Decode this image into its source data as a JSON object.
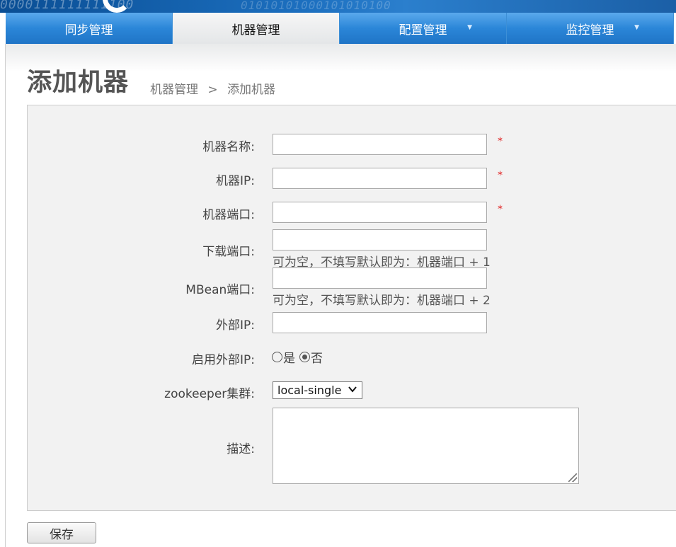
{
  "banner": {
    "digits_left": "0000111111111100",
    "digits_right": "01010101000101010100"
  },
  "nav": {
    "tabs": [
      {
        "label": "同步管理",
        "active": false,
        "has_dropdown": false
      },
      {
        "label": "机器管理",
        "active": true,
        "has_dropdown": false
      },
      {
        "label": "配置管理",
        "active": false,
        "has_dropdown": true
      },
      {
        "label": "监控管理",
        "active": false,
        "has_dropdown": true
      }
    ],
    "dropdown_caret": "▼"
  },
  "page": {
    "title": "添加机器",
    "breadcrumb": {
      "parent": "机器管理",
      "separator": ">",
      "current": "添加机器"
    }
  },
  "form": {
    "required_mark": "*",
    "machine_name": {
      "label": "机器名称:",
      "value": ""
    },
    "machine_ip": {
      "label": "机器IP:",
      "value": ""
    },
    "machine_port": {
      "label": "机器端口:",
      "value": ""
    },
    "download_port": {
      "label": "下载端口:",
      "value": "",
      "hint": "可为空，不填写默认即为：机器端口 + 1"
    },
    "mbean_port": {
      "label": "MBean端口:",
      "value": "",
      "hint": "可为空，不填写默认即为：机器端口 + 2"
    },
    "external_ip": {
      "label": "外部IP:",
      "value": ""
    },
    "enable_external_ip": {
      "label": "启用外部IP:",
      "options": [
        "是",
        "否"
      ],
      "selected": "否"
    },
    "zookeeper_cluster": {
      "label": "zookeeper集群:",
      "selected": "local-single"
    },
    "description": {
      "label": "描述:",
      "value": ""
    },
    "save_label": "保存"
  }
}
